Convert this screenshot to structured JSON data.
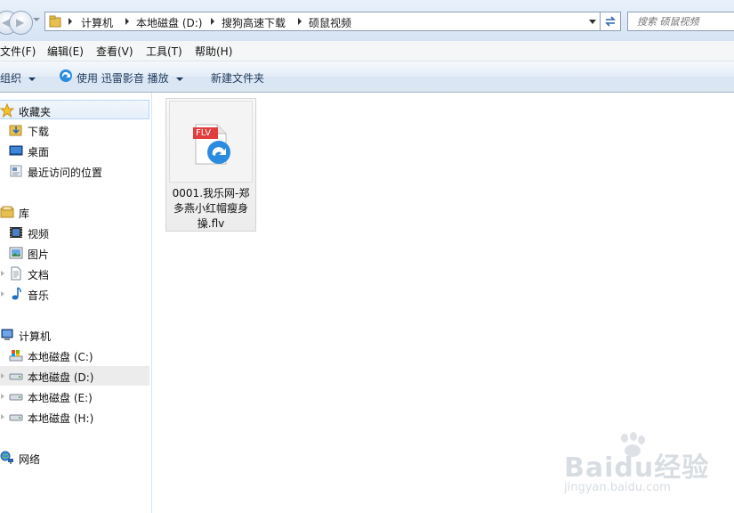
{
  "address": {
    "crumbs": [
      "计算机",
      "本地磁盘 (D:)",
      "搜狗高速下载",
      "硕鼠视频"
    ]
  },
  "search": {
    "placeholder": "搜索 硕鼠视频"
  },
  "menu": [
    "文件(F)",
    "编辑(E)",
    "查看(V)",
    "工具(T)",
    "帮助(H)"
  ],
  "toolbar": {
    "organize": "组织",
    "play_with": "使用 迅雷影音 播放",
    "new_folder": "新建文件夹"
  },
  "nav": {
    "favorites": {
      "title": "收藏夹",
      "items": [
        "下载",
        "桌面",
        "最近访问的位置"
      ]
    },
    "libraries": {
      "title": "库",
      "items": [
        "视频",
        "图片",
        "文档",
        "音乐"
      ]
    },
    "computer": {
      "title": "计算机",
      "items": [
        "本地磁盘 (C:)",
        "本地磁盘 (D:)",
        "本地磁盘 (E:)",
        "本地磁盘 (H:)"
      ]
    },
    "network": {
      "title": "网络"
    }
  },
  "files": [
    {
      "name": "0001.我乐网-郑多燕小红帽瘦身操.flv",
      "badge": "FLV",
      "icon": "flv-file-icon"
    }
  ],
  "watermark": {
    "brand": "Baidu经验",
    "url": "jingyan.baidu.com"
  },
  "colors": {
    "accent": "#1e395b",
    "selection": "#b8d6fb",
    "flv_badge": "#e23d3d"
  }
}
